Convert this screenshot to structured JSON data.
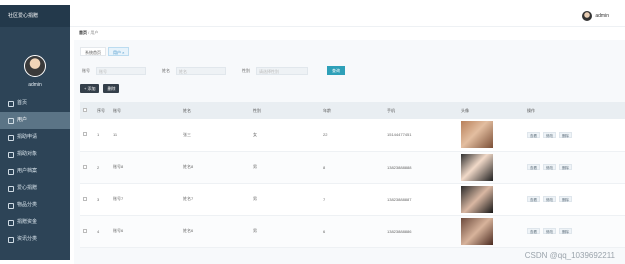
{
  "sidebar": {
    "brand": "社区爱心捐赠",
    "admin_name": "admin",
    "items": [
      {
        "label": "首页"
      },
      {
        "label": "用户"
      },
      {
        "label": "捐助申请"
      },
      {
        "label": "捐助对象"
      },
      {
        "label": "用户档案"
      },
      {
        "label": "爱心捐赠"
      },
      {
        "label": "物品分类"
      },
      {
        "label": "捐赠资金"
      },
      {
        "label": "资讯分类"
      }
    ]
  },
  "topbar": {
    "user": "admin"
  },
  "breadcrumb": {
    "home": "首页",
    "sep": "/",
    "current": "用户"
  },
  "tabs": [
    {
      "label": "系统首页"
    },
    {
      "label": "用户 ×"
    }
  ],
  "search": {
    "account_label": "账号",
    "account_placeholder": "账号",
    "name_label": "姓名",
    "name_placeholder": "姓名",
    "gender_label": "性别",
    "gender_placeholder": "请选择性别",
    "query_button": "查询"
  },
  "actions": {
    "add": "+ 添加",
    "delete": "删除"
  },
  "table": {
    "headers": [
      "",
      "序号",
      "账号",
      "姓名",
      "性别",
      "年龄",
      "手机",
      "头像",
      "操作"
    ],
    "rows": [
      {
        "no": "1",
        "account": "11",
        "name": "张三",
        "gender": "女",
        "age": "22",
        "phone": "15144477451"
      },
      {
        "no": "2",
        "account": "账号8",
        "name": "姓名8",
        "gender": "男",
        "age": "8",
        "phone": "13823888888"
      },
      {
        "no": "3",
        "account": "账号7",
        "name": "姓名7",
        "gender": "男",
        "age": "7",
        "phone": "13823888887"
      },
      {
        "no": "4",
        "account": "账号6",
        "name": "姓名6",
        "gender": "男",
        "age": "6",
        "phone": "13823888886"
      }
    ],
    "op_labels": {
      "view": "查看",
      "edit": "修改",
      "delete": "删除"
    }
  },
  "watermark": "CSDN @qq_1039692211",
  "colors": {
    "sidebar": "#2d4457",
    "accent": "#2ea0b8",
    "active_menu": "#5b7486"
  }
}
